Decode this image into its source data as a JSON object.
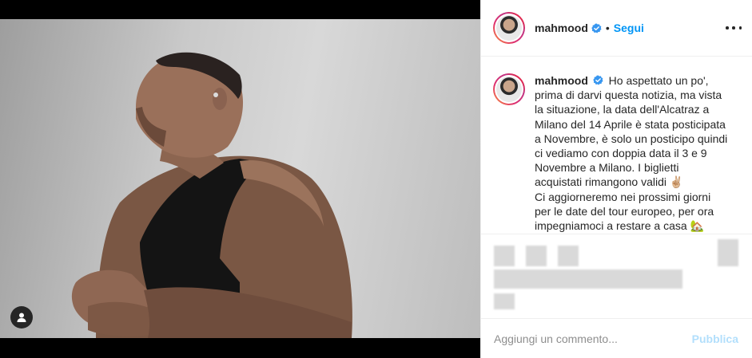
{
  "post": {
    "username": "mahmood",
    "follow_label": "Segui",
    "separator": "•",
    "caption_lines": [
      "Ho aspettato un po',",
      "prima di darvi questa notizia, ma vista",
      "la situazione, la data dell'Alcatraz a",
      "Milano del 14 Aprile è stata posticipata",
      "a Novembre, è solo un posticipo quindi",
      "ci vediamo con doppia data il 3 e 9",
      "Novembre a Milano. I biglietti",
      "acquistati rimangono validi ✌🏼",
      "Ci aggiorneremo nei prossimi giorni",
      "per le date del tour europeo, per ora",
      "impegniamoci a restare a casa 🏡"
    ]
  },
  "comment": {
    "placeholder": "Aggiungi un commento...",
    "publish_label": "Pubblica"
  },
  "icons": {
    "verified": "verified-badge-icon",
    "more": "more-options-icon",
    "user_tag": "user-tags-icon"
  },
  "colors": {
    "link": "#0095f6",
    "publish_disabled": "#b2dffc",
    "verified": "#3897f0"
  }
}
